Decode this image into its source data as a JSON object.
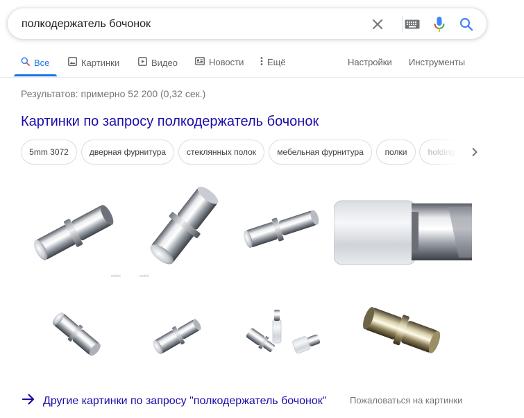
{
  "search": {
    "query": "полкодержатель бочонок",
    "icons": {
      "clear": "close-icon",
      "keyboard": "keyboard-icon",
      "voice": "microphone-icon",
      "search": "search-icon"
    }
  },
  "tabs": [
    {
      "label": "Все",
      "icon": "search-icon",
      "active": true
    },
    {
      "label": "Картинки",
      "icon": "image-icon"
    },
    {
      "label": "Видео",
      "icon": "video-icon"
    },
    {
      "label": "Новости",
      "icon": "news-icon"
    },
    {
      "label": "Ещё",
      "icon": "more-vert-icon"
    }
  ],
  "tools": {
    "settings": "Настройки",
    "instruments": "Инструменты"
  },
  "results_count": "Результатов: примерно 52 200 (0,32 сек.)",
  "images": {
    "title": "Картинки по запросу полкодержатель бочонок",
    "chips": [
      "5mm 3072",
      "дверная фурнитура",
      "стеклянных полок",
      "мебельная фурнитура",
      "полки",
      "holding"
    ],
    "more": "Другие картинки по запросу \"полкодержатель бочонок\"",
    "report": "Пожаловаться на картинки"
  },
  "colors": {
    "link": "#1a0dab",
    "accent": "#1a73e8",
    "muted": "#70757a"
  }
}
